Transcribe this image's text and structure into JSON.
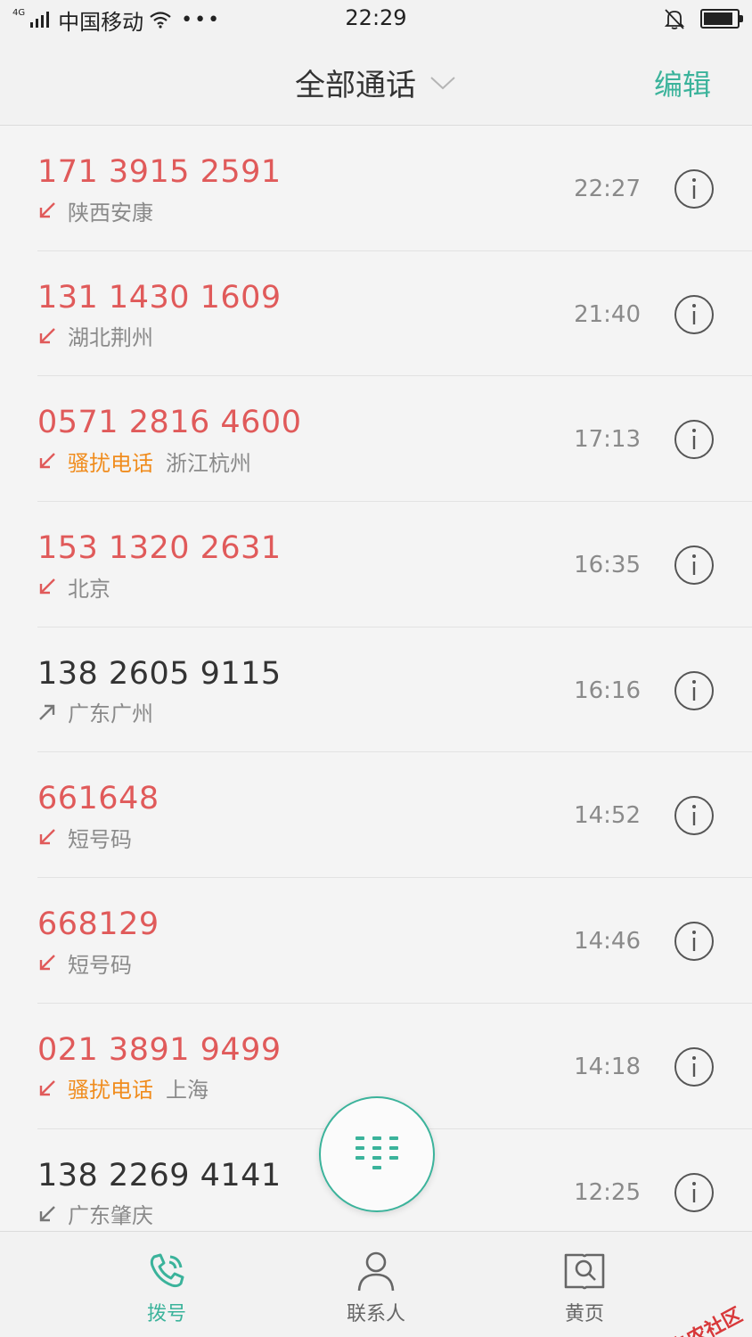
{
  "status_bar": {
    "network": "4G",
    "carrier": "中国移动",
    "time": "22:29",
    "battery_level": 0.9
  },
  "header": {
    "title": "全部通话",
    "edit_label": "编辑"
  },
  "colors": {
    "accent": "#3bb39b",
    "missed": "#e05a5a",
    "spam_tag": "#f08c1d",
    "secondary_text": "#8a8a8a"
  },
  "calls": [
    {
      "number": "171 3915 2591",
      "missed": true,
      "direction": "incoming",
      "tag": "",
      "location": "陕西安康",
      "time": "22:27"
    },
    {
      "number": "131 1430 1609",
      "missed": true,
      "direction": "incoming",
      "tag": "",
      "location": "湖北荆州",
      "time": "21:40"
    },
    {
      "number": "0571 2816 4600",
      "missed": true,
      "direction": "incoming",
      "tag": "骚扰电话",
      "location": "浙江杭州",
      "time": "17:13"
    },
    {
      "number": "153 1320 2631",
      "missed": true,
      "direction": "incoming",
      "tag": "",
      "location": "北京",
      "time": "16:35"
    },
    {
      "number": "138 2605 9115",
      "missed": false,
      "direction": "outgoing",
      "tag": "",
      "location": "广东广州",
      "time": "16:16"
    },
    {
      "number": "661648",
      "missed": true,
      "direction": "incoming",
      "tag": "",
      "location": "短号码",
      "time": "14:52"
    },
    {
      "number": "668129",
      "missed": true,
      "direction": "incoming",
      "tag": "",
      "location": "短号码",
      "time": "14:46"
    },
    {
      "number": "021 3891 9499",
      "missed": true,
      "direction": "incoming",
      "tag": "骚扰电话",
      "location": "上海",
      "time": "14:18"
    },
    {
      "number": "138 2269 4141",
      "missed": false,
      "direction": "incoming",
      "tag": "",
      "location": "广东肇庆",
      "time": "12:25"
    }
  ],
  "bottom_nav": [
    {
      "label": "拨号",
      "icon": "phone-icon",
      "active": true
    },
    {
      "label": "联系人",
      "icon": "person-icon",
      "active": false
    },
    {
      "label": "黄页",
      "icon": "yellow-pages-icon",
      "active": false
    }
  ],
  "watermark": {
    "text": "卡农社区"
  }
}
